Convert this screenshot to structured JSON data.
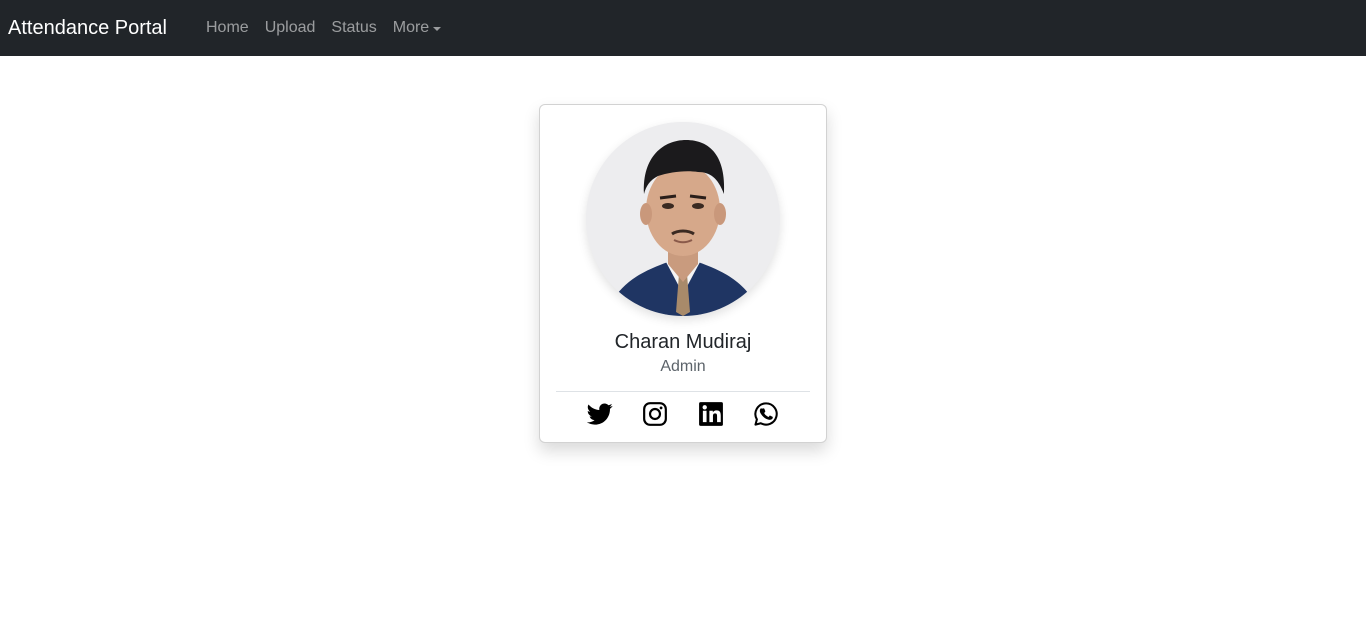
{
  "navbar": {
    "brand": "Attendance Portal",
    "links": [
      {
        "label": "Home"
      },
      {
        "label": "Upload"
      },
      {
        "label": "Status"
      },
      {
        "label": "More"
      }
    ]
  },
  "profile": {
    "name": "Charan Mudiraj",
    "role": "Admin",
    "avatar_icon": "profile-photo",
    "socials": [
      {
        "icon": "twitter-icon"
      },
      {
        "icon": "instagram-icon"
      },
      {
        "icon": "linkedin-icon"
      },
      {
        "icon": "whatsapp-icon"
      }
    ]
  },
  "colors": {
    "navbar_bg": "#212529",
    "brand_text": "#ffffff",
    "nav_link": "rgba(255,255,255,0.55)",
    "card_border": "rgba(0,0,0,0.175)",
    "icon": "#000000"
  }
}
